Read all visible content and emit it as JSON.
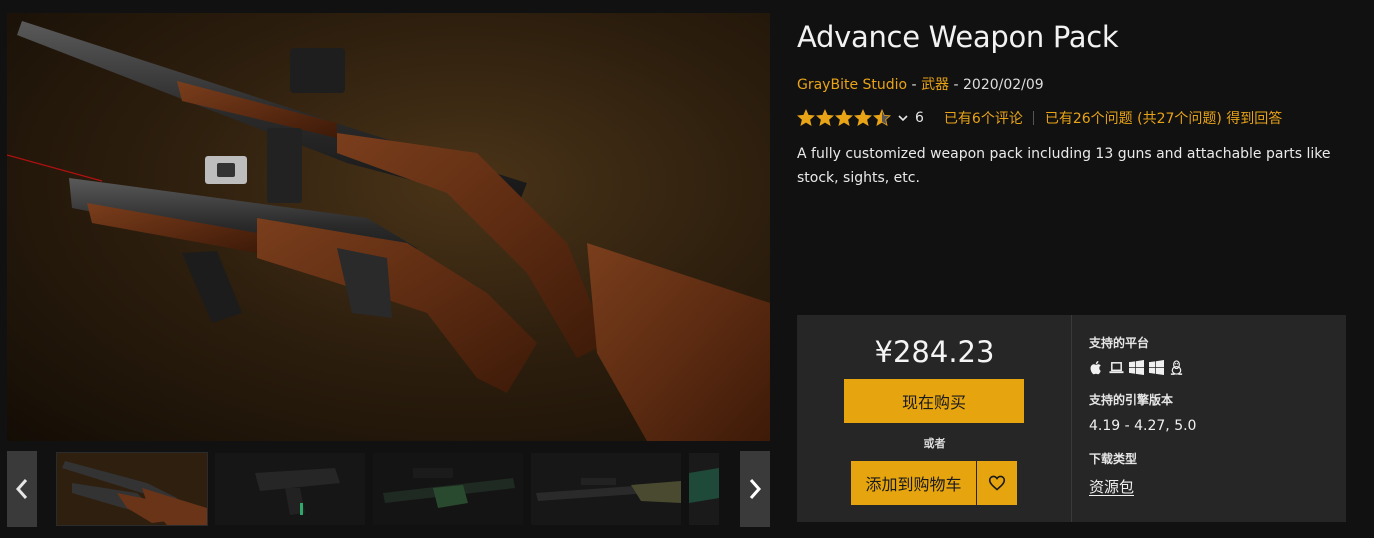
{
  "product": {
    "title": "Advance Weapon Pack",
    "seller": "GrayBite Studio",
    "separator": " - ",
    "category": "武器",
    "date": "2020/02/09",
    "description": "A fully customized weapon pack including 13 guns and attachable parts like stock, sights, etc."
  },
  "rating": {
    "stars": 4.5,
    "max_stars": 5,
    "count": "6",
    "reviews_link": "已有6个评论",
    "questions_link": "已有26个问题 (共27个问题) 得到回答",
    "star_color": "#e8a317"
  },
  "purchase": {
    "price": "¥284.23",
    "buy_label": "现在购买",
    "or_label": "或者",
    "cart_label": "添加到购物车",
    "accent_color": "#e6a50f"
  },
  "details": {
    "platforms_label": "支持的平台",
    "platforms": [
      "apple-icon",
      "laptop-icon",
      "windows-icon",
      "windows-icon",
      "linux-icon"
    ],
    "engine_label": "支持的引擎版本",
    "engine_versions": "4.19 - 4.27, 5.0",
    "download_label": "下载类型",
    "download_type": "资源包"
  },
  "gallery": {
    "thumbnails": [
      "shotgun-thumbnail",
      "smg-thumbnail",
      "green-rifle-thumbnail",
      "sniper-rifle-thumbnail",
      "partial-thumbnail"
    ]
  }
}
